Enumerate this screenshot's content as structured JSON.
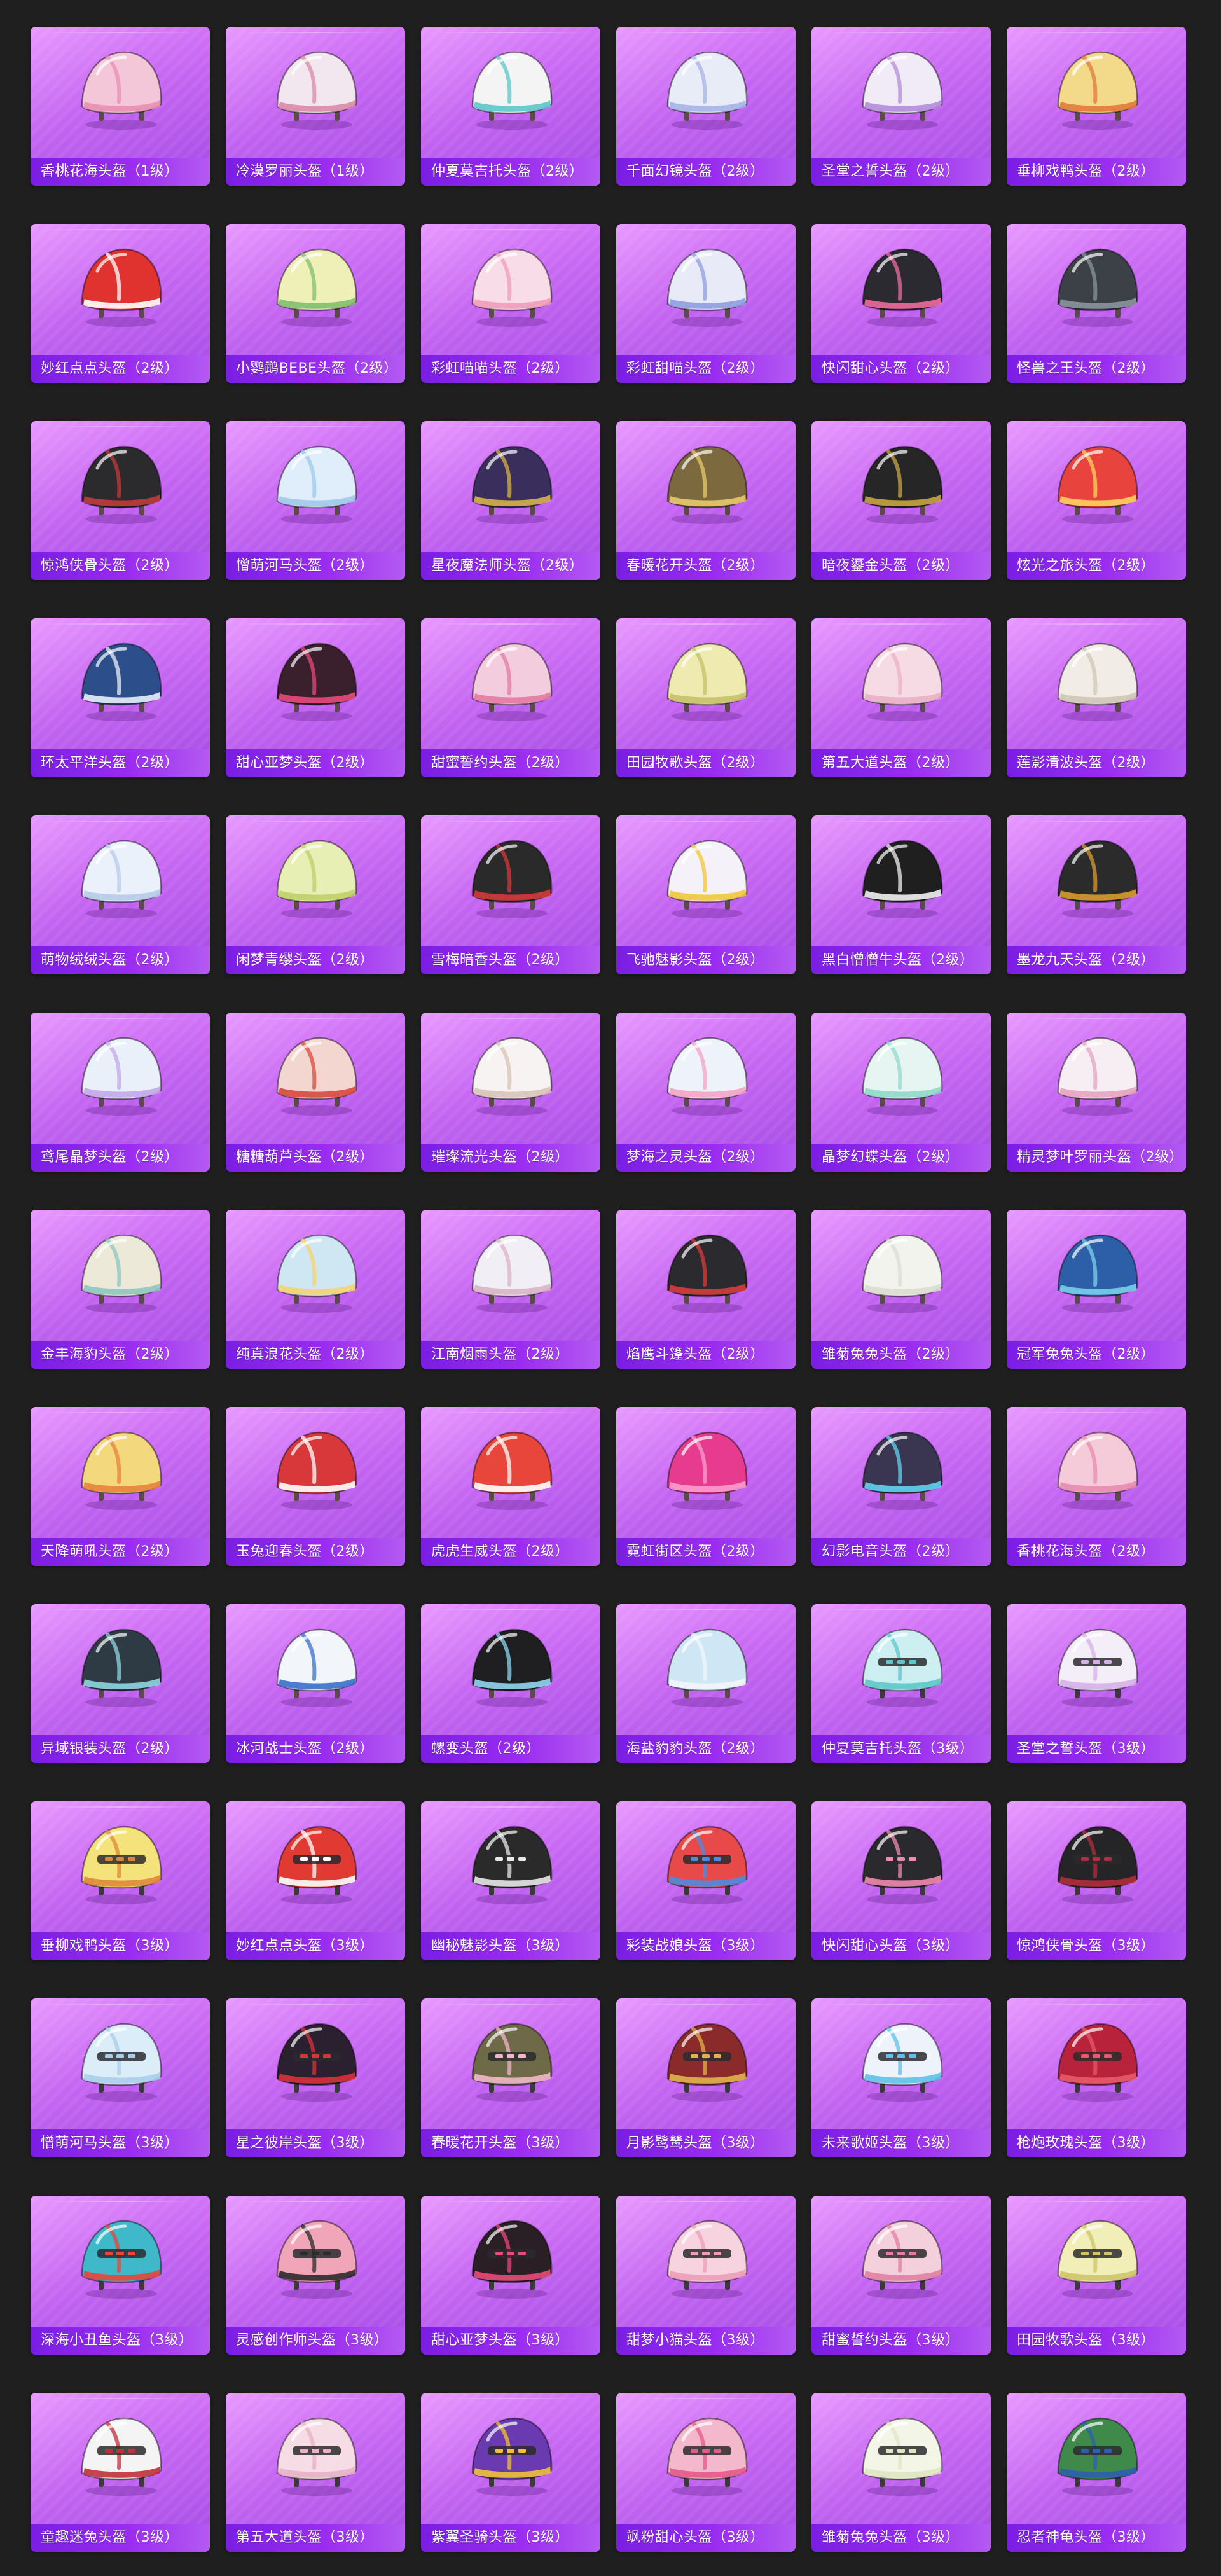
{
  "helmets": [
    {
      "name": "香桃花海头盔（1级）",
      "level": 1,
      "color": "#f3c6d8",
      "accent": "#e88fb1"
    },
    {
      "name": "冷漠罗丽头盔（1级）",
      "level": 1,
      "color": "#f2e6ef",
      "accent": "#d98aa8"
    },
    {
      "name": "仲夏莫吉托头盔（2级）",
      "level": 2,
      "color": "#f4f4f4",
      "accent": "#5fc6c9"
    },
    {
      "name": "千面幻镜头盔（2级）",
      "level": 2,
      "color": "#e8ecf6",
      "accent": "#a6b4e8"
    },
    {
      "name": "圣堂之誓头盔（2级）",
      "level": 2,
      "color": "#f1eaf7",
      "accent": "#b38cd9"
    },
    {
      "name": "垂柳戏鸭头盔（2级）",
      "level": 2,
      "color": "#f3d98a",
      "accent": "#e07a3a"
    },
    {
      "name": "妙红点点头盔（2级）",
      "level": 2,
      "color": "#e0322e",
      "accent": "#ffffff"
    },
    {
      "name": "小鹦鹉BEBE头盔（2级）",
      "level": 2,
      "color": "#eef0b8",
      "accent": "#7fbf6a"
    },
    {
      "name": "彩虹喵喵头盔（2级）",
      "level": 2,
      "color": "#f8dde8",
      "accent": "#f09bb9"
    },
    {
      "name": "彩虹甜喵头盔（2级）",
      "level": 2,
      "color": "#e9eaf8",
      "accent": "#8f9de0"
    },
    {
      "name": "快闪甜心头盔（2级）",
      "level": 2,
      "color": "#2a2a30",
      "accent": "#f06a9e"
    },
    {
      "name": "怪兽之王头盔（2级）",
      "level": 2,
      "color": "#3b4146",
      "accent": "#8a959c"
    },
    {
      "name": "惊鸿侠骨头盔（2级）",
      "level": 2,
      "color": "#2b2b2e",
      "accent": "#c23a3a"
    },
    {
      "name": "憎萌河马头盔（2级）",
      "level": 2,
      "color": "#dfeefa",
      "accent": "#9fc8ea"
    },
    {
      "name": "星夜魔法师头盔（2级）",
      "level": 2,
      "color": "#3a2f5c",
      "accent": "#d8b24a"
    },
    {
      "name": "春暖花开头盔（2级）",
      "level": 2,
      "color": "#7c6a3e",
      "accent": "#e9c96a"
    },
    {
      "name": "暗夜鎏金头盔（2级）",
      "level": 2,
      "color": "#262626",
      "accent": "#c9a441"
    },
    {
      "name": "炫光之旅头盔（2级）",
      "level": 2,
      "color": "#e8433d",
      "accent": "#ffd35c"
    },
    {
      "name": "环太平洋头盔（2级）",
      "level": 2,
      "color": "#2c4f8c",
      "accent": "#e9eef7"
    },
    {
      "name": "甜心亚梦头盔（2级）",
      "level": 2,
      "color": "#3a1f2c",
      "accent": "#e84a7a"
    },
    {
      "name": "甜蜜誓约头盔（2级）",
      "level": 2,
      "color": "#f3cddd",
      "accent": "#e37aa2"
    },
    {
      "name": "田园牧歌头盔（2级）",
      "level": 2,
      "color": "#eeeab0",
      "accent": "#c6c06a"
    },
    {
      "name": "第五大道头盔（2级）",
      "level": 2,
      "color": "#f6dbe4",
      "accent": "#e9b0c4"
    },
    {
      "name": "莲影清波头盔（2级）",
      "level": 2,
      "color": "#f1ede6",
      "accent": "#cfc5b3"
    },
    {
      "name": "萌物绒绒头盔（2级）",
      "level": 2,
      "color": "#eaf1fb",
      "accent": "#b7cbe8"
    },
    {
      "name": "闲梦青缨头盔（2级）",
      "level": 2,
      "color": "#e8efb4",
      "accent": "#bfcf6a"
    },
    {
      "name": "雪梅暗香头盔（2级）",
      "level": 2,
      "color": "#2a2a2a",
      "accent": "#d43b3b"
    },
    {
      "name": "飞驰魅影头盔（2级）",
      "level": 2,
      "color": "#f4f2f8",
      "accent": "#f0c63a"
    },
    {
      "name": "黑白憎憎牛头盔（2级）",
      "level": 2,
      "color": "#1f1f1f",
      "accent": "#f2f2f2"
    },
    {
      "name": "墨龙九天头盔（2级）",
      "level": 2,
      "color": "#2b2b2b",
      "accent": "#d89b2f"
    },
    {
      "name": "鸢尾晶梦头盔（2级）",
      "level": 2,
      "color": "#eaf0fa",
      "accent": "#c2a7e8"
    },
    {
      "name": "糖糖葫芦头盔（2级）",
      "level": 2,
      "color": "#f2d6cf",
      "accent": "#d8493d"
    },
    {
      "name": "璀璨流光头盔（2级）",
      "level": 2,
      "color": "#f6f3f2",
      "accent": "#d9c3b8"
    },
    {
      "name": "梦海之灵头盔（2级）",
      "level": 2,
      "color": "#eef2fb",
      "accent": "#f2a4c6"
    },
    {
      "name": "晶梦幻蝶头盔（2级）",
      "level": 2,
      "color": "#e6f5f2",
      "accent": "#8fd9cc"
    },
    {
      "name": "精灵梦叶罗丽头盔（2级）",
      "level": 2,
      "color": "#f6eef3",
      "accent": "#e6a3c2"
    },
    {
      "name": "金丰海豹头盔（2级）",
      "level": 2,
      "color": "#ece9d8",
      "accent": "#8fc7c2"
    },
    {
      "name": "纯真浪花头盔（2级）",
      "level": 2,
      "color": "#cfe7f3",
      "accent": "#f6d36f"
    },
    {
      "name": "江南烟雨头盔（2级）",
      "level": 2,
      "color": "#f2eef6",
      "accent": "#d9b3c6"
    },
    {
      "name": "焰鹰斗篷头盔（2级）",
      "level": 2,
      "color": "#2b2b2f",
      "accent": "#d93b3b"
    },
    {
      "name": "雏菊兔兔头盔（2级）",
      "level": 2,
      "color": "#f3f3ee",
      "accent": "#dcdcd2"
    },
    {
      "name": "冠军兔兔头盔（2级）",
      "level": 2,
      "color": "#2c5fa8",
      "accent": "#7ad0e8"
    },
    {
      "name": "天降萌吼头盔（2级）",
      "level": 2,
      "color": "#f4d87e",
      "accent": "#e8833a"
    },
    {
      "name": "玉兔迎春头盔（2级）",
      "level": 2,
      "color": "#d8383a",
      "accent": "#ffffff"
    },
    {
      "name": "虎虎生威头盔（2级）",
      "level": 2,
      "color": "#e8463a",
      "accent": "#ffffff"
    },
    {
      "name": "霓虹街区头盔（2级）",
      "level": 2,
      "color": "#e63b8e",
      "accent": "#ff9ccf"
    },
    {
      "name": "幻影电音头盔（2级）",
      "level": 2,
      "color": "#3a3550",
      "accent": "#5fd3f0"
    },
    {
      "name": "香桃花海头盔（2级）",
      "level": 2,
      "color": "#f6cbd9",
      "accent": "#e98bb0"
    },
    {
      "name": "异域银装头盔（2级）",
      "level": 2,
      "color": "#2f3b44",
      "accent": "#8fd7e0"
    },
    {
      "name": "冰河战士头盔（2级）",
      "level": 2,
      "color": "#f2f6fb",
      "accent": "#3a6fc9"
    },
    {
      "name": "螺变头盔（2级）",
      "level": 2,
      "color": "#1f1f22",
      "accent": "#8fd7f0"
    },
    {
      "name": "海盐豹豹头盔（2级）",
      "level": 2,
      "color": "#cfe7f4",
      "accent": "#f0f6fb"
    },
    {
      "name": "仲夏莫吉托头盔（3级）",
      "level": 3,
      "color": "#cdeff1",
      "accent": "#5fc6c9"
    },
    {
      "name": "圣堂之誓头盔（3级）",
      "level": 3,
      "color": "#f3eef8",
      "accent": "#d7b0e8"
    },
    {
      "name": "垂柳戏鸭头盔（3级）",
      "level": 3,
      "color": "#f3e37a",
      "accent": "#e0873a"
    },
    {
      "name": "妙红点点头盔（3级）",
      "level": 3,
      "color": "#e03a33",
      "accent": "#ffffff"
    },
    {
      "name": "幽秘魅影头盔（3级）",
      "level": 3,
      "color": "#2a2a2a",
      "accent": "#e8e8e8"
    },
    {
      "name": "彩装战娘头盔（3级）",
      "level": 3,
      "color": "#e84a4a",
      "accent": "#4a8de0"
    },
    {
      "name": "快闪甜心头盔（3级）",
      "level": 3,
      "color": "#2a2a2e",
      "accent": "#f08aae"
    },
    {
      "name": "惊鸿侠骨头盔（3级）",
      "level": 3,
      "color": "#252527",
      "accent": "#b02e3a"
    },
    {
      "name": "憎萌河马头盔（3级）",
      "level": 3,
      "color": "#dcedfa",
      "accent": "#a9cdea"
    },
    {
      "name": "星之彼岸头盔（3级）",
      "level": 3,
      "color": "#2a2030",
      "accent": "#d8323a"
    },
    {
      "name": "春暖花开头盔（3级）",
      "level": 3,
      "color": "#6e6a48",
      "accent": "#f0b8c8"
    },
    {
      "name": "月影鹭鸶头盔（3级）",
      "level": 3,
      "color": "#8a2a2a",
      "accent": "#e0b24a"
    },
    {
      "name": "未来歌姬头盔（3级）",
      "level": 3,
      "color": "#eef3fb",
      "accent": "#5fc0e8"
    },
    {
      "name": "枪炮玫瑰头盔（3级）",
      "level": 3,
      "color": "#b8223a",
      "accent": "#e85a6a"
    },
    {
      "name": "深海小丑鱼头盔（3级）",
      "level": 3,
      "color": "#3fb8c9",
      "accent": "#e8463a"
    },
    {
      "name": "灵感创作师头盔（3级）",
      "level": 3,
      "color": "#f0a6b8",
      "accent": "#2a2a2a"
    },
    {
      "name": "甜心亚梦头盔（3级）",
      "level": 3,
      "color": "#2a1f24",
      "accent": "#e84a7a"
    },
    {
      "name": "甜梦小猫头盔（3级）",
      "level": 3,
      "color": "#f6d3de",
      "accent": "#ee9cb8"
    },
    {
      "name": "甜蜜誓约头盔（3级）",
      "level": 3,
      "color": "#f3d0dc",
      "accent": "#e27ea3"
    },
    {
      "name": "田园牧歌头盔（3级）",
      "level": 3,
      "color": "#f2eeb8",
      "accent": "#cfc46a"
    },
    {
      "name": "童趣迷兔头盔（3级）",
      "level": 3,
      "color": "#f4f4f4",
      "accent": "#c2303a"
    },
    {
      "name": "第五大道头盔（3级）",
      "level": 3,
      "color": "#f6dce5",
      "accent": "#e8b2c6"
    },
    {
      "name": "紫翼圣骑头盔（3级）",
      "level": 3,
      "color": "#6a3ab0",
      "accent": "#f0c23a"
    },
    {
      "name": "飒粉甜心头盔（3级）",
      "level": 3,
      "color": "#f3b8cb",
      "accent": "#e35a8a"
    },
    {
      "name": "雏菊兔兔头盔（3级）",
      "level": 3,
      "color": "#f3f6e6",
      "accent": "#dfe6c2"
    },
    {
      "name": "忍者神龟头盔（3级）",
      "level": 3,
      "color": "#3f8a4a",
      "accent": "#2c5fb0"
    }
  ]
}
